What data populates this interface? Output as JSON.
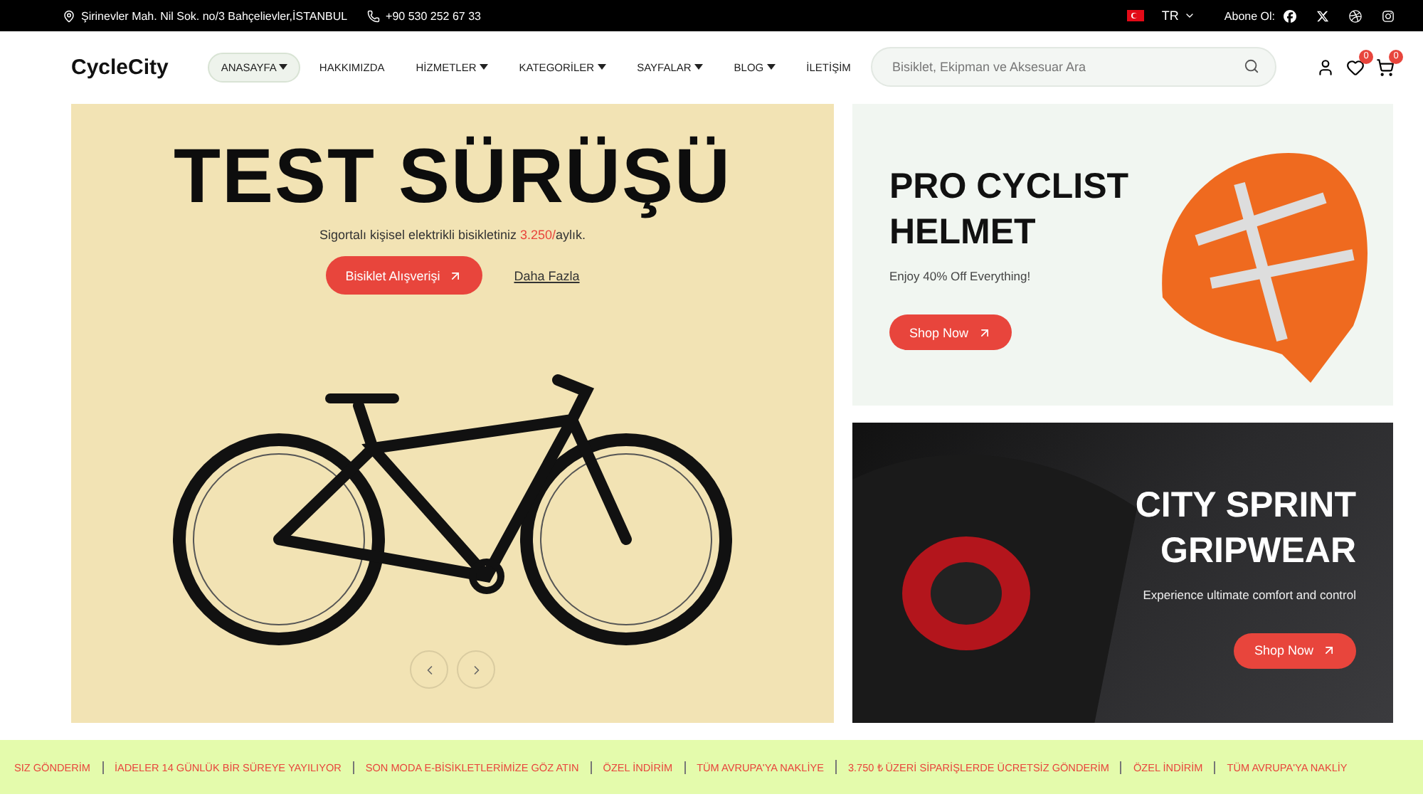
{
  "top_bar": {
    "address": "Şirinevler Mah. Nil Sok. no/3 Bahçelievler,İSTANBUL",
    "phone": "+90 530 252 67 33",
    "language": "TR",
    "subscribe_label": "Abone Ol:"
  },
  "header": {
    "logo": "CycleCity",
    "nav": [
      {
        "label": "ANASAYFA",
        "has_dropdown": true,
        "selected": true
      },
      {
        "label": "HAKKIMIZDA",
        "has_dropdown": false,
        "selected": false
      },
      {
        "label": "HİZMETLER",
        "has_dropdown": true,
        "selected": false
      },
      {
        "label": "KATEGORİLER",
        "has_dropdown": true,
        "selected": false
      },
      {
        "label": "SAYFALAR",
        "has_dropdown": true,
        "selected": false
      },
      {
        "label": "BLOG",
        "has_dropdown": true,
        "selected": false
      },
      {
        "label": "İLETİŞİM",
        "has_dropdown": false,
        "selected": false
      }
    ],
    "search": {
      "placeholder": "Bisiklet, Ekipman ve Aksesuar Ara"
    },
    "wishlist_count": "0",
    "cart_count": "0"
  },
  "hero": {
    "title": "TEST SÜRÜŞÜ",
    "subtitle": {
      "before": "Sigortalı kişisel elektrikli bisikletiniz ",
      "highlight": "3.250/",
      "after": "aylık."
    },
    "primary_button": "Bisiklet Alışverişi",
    "secondary_link": "Daha Fazla"
  },
  "promos": [
    {
      "kind": "light",
      "title_lines": [
        "PRO CYCLIST",
        "HELMET"
      ],
      "text": "Enjoy 40% Off Everything!",
      "button": "Shop Now"
    },
    {
      "kind": "dark",
      "title_lines": [
        "CITY SPRINT",
        "GRIPWEAR"
      ],
      "text": "Experience ultimate comfort and control",
      "button": "Shop Now"
    }
  ],
  "ticker": [
    "SIZ GÖNDERİM",
    "İADELER 14 GÜNLÜK BİR SÜREYE YAYILIYOR",
    "SON MODA E-BİSİKLETLERİMİZE GÖZ ATIN",
    "ÖZEL İNDİRİM",
    "TÜM AVRUPA'YA NAKLİYE",
    "3.750 ₺ ÜZERİ SİPARİŞLERDE ÜCRETSİZ GÖNDERİM",
    "ÖZEL İNDİRİM",
    "TÜM AVRUPA'YA NAKLİY"
  ]
}
